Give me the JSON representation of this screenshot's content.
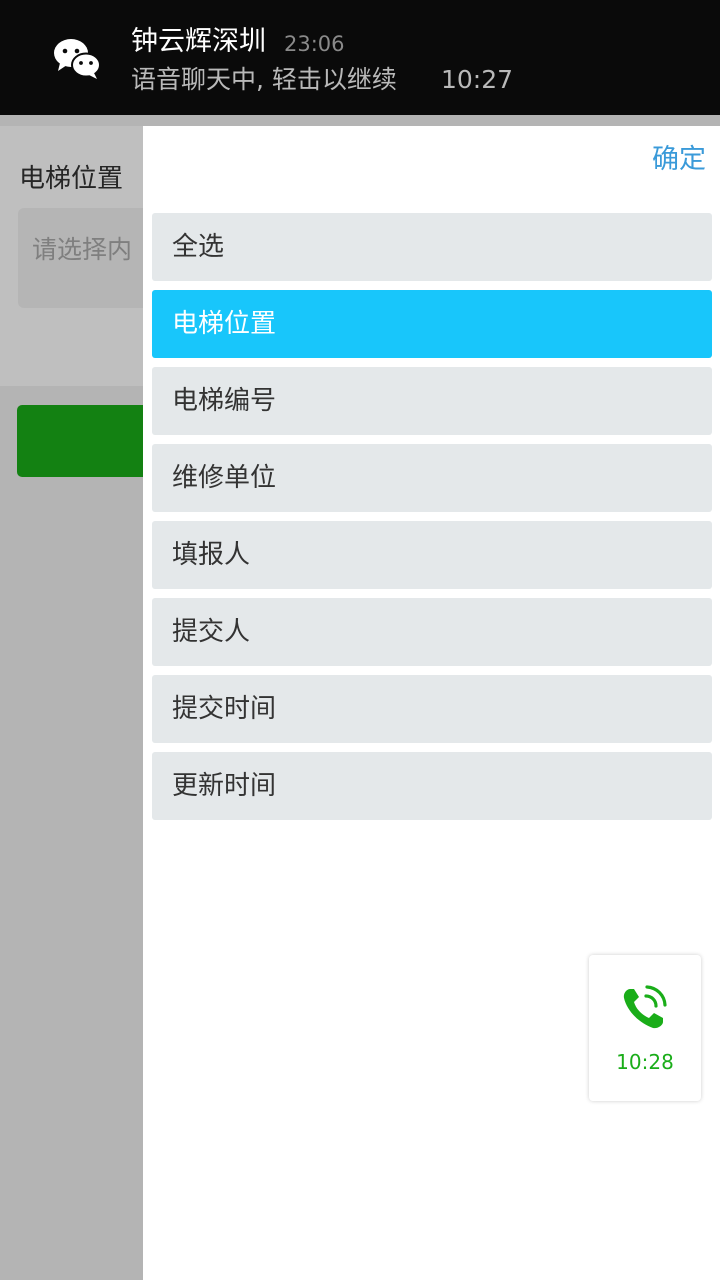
{
  "notification": {
    "title": "钟云辉深圳",
    "time": "23:06",
    "text": "语音聊天中, 轻击以继续",
    "duration": "10:27",
    "icon": "wechat-icon"
  },
  "underlay": {
    "field_label": "电梯位置",
    "field_placeholder": "请选择内",
    "button_color": "#1aad19"
  },
  "drawer": {
    "confirm_label": "确定",
    "options": [
      {
        "label": "全选",
        "selected": false
      },
      {
        "label": "电梯位置",
        "selected": true
      },
      {
        "label": "电梯编号",
        "selected": false
      },
      {
        "label": "维修单位",
        "selected": false
      },
      {
        "label": "填报人",
        "selected": false
      },
      {
        "label": "提交人",
        "selected": false
      },
      {
        "label": "提交时间",
        "selected": false
      },
      {
        "label": "更新时间",
        "selected": false
      }
    ],
    "accent_color": "#18c6fb"
  },
  "call_widget": {
    "time": "10:28",
    "icon": "phone-call-icon",
    "color": "#1aad19"
  }
}
